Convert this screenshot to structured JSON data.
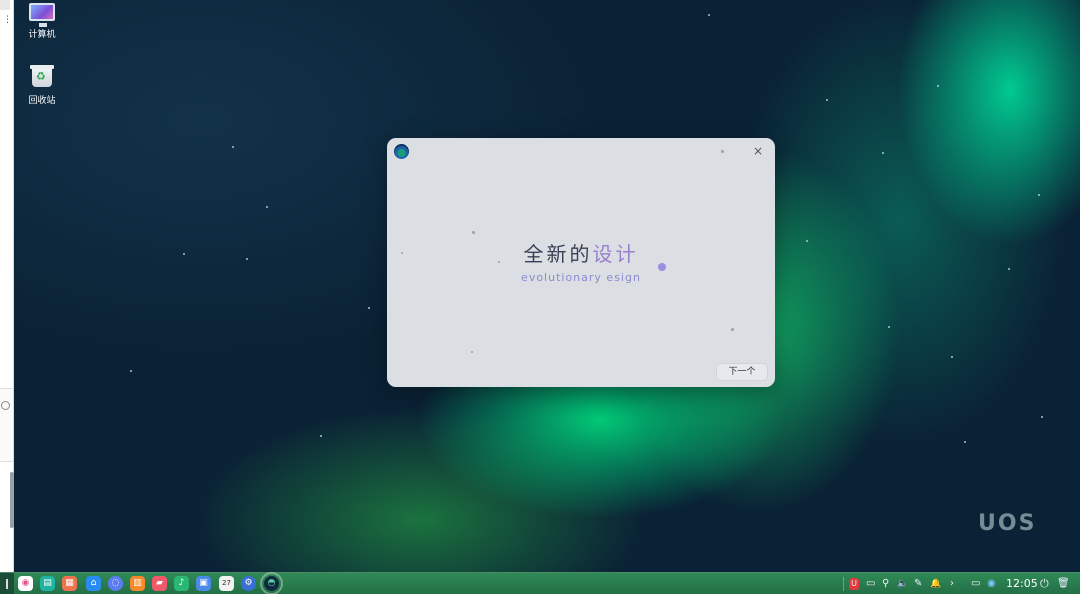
{
  "desktop": {
    "icons": [
      {
        "label": "计算机",
        "icon": "computer-icon"
      },
      {
        "label": "回收站",
        "icon": "trash-icon"
      }
    ],
    "watermark": "UOS"
  },
  "dialog": {
    "title_dark": "全新的",
    "title_light": "设计",
    "subtitle": "evolutionary  esign",
    "close_glyph": "×",
    "next_label": "下一个"
  },
  "taskbar": {
    "apps": [
      {
        "name": "launcher-icon",
        "color": "#ffffff",
        "glyph": "◉"
      },
      {
        "name": "multitask-view-icon",
        "color": "#1fb3a2",
        "glyph": "▤"
      },
      {
        "name": "file-manager-icon",
        "color": "#f0734f",
        "glyph": "▦"
      },
      {
        "name": "app-store-icon",
        "color": "#2a8cf0",
        "glyph": "⌂"
      },
      {
        "name": "browser-icon",
        "color": "#5e7cf2",
        "glyph": "◌"
      },
      {
        "name": "music-icon",
        "color": "#f58a2a",
        "glyph": "▥"
      },
      {
        "name": "image-viewer-icon",
        "color": "#ef5a6b",
        "glyph": "▰"
      },
      {
        "name": "video-icon",
        "color": "#2bb673",
        "glyph": "♪"
      },
      {
        "name": "document-icon",
        "color": "#4a8bea",
        "glyph": "▣"
      },
      {
        "name": "calendar-icon",
        "color": "#f2f2f2",
        "glyph": "27"
      },
      {
        "name": "settings-icon",
        "color": "#3b6fd8",
        "glyph": "⚙"
      },
      {
        "name": "uos-welcome-icon",
        "color": "#0f2a3f",
        "glyph": "◓"
      }
    ],
    "tray": [
      {
        "name": "security-center-icon",
        "glyph": "U"
      },
      {
        "name": "keyboard-icon",
        "glyph": "▭"
      },
      {
        "name": "usb-icon",
        "glyph": "⚲"
      },
      {
        "name": "volume-icon",
        "glyph": "🔈"
      },
      {
        "name": "pen-icon",
        "glyph": "✎"
      },
      {
        "name": "notification-icon",
        "glyph": "🔔"
      },
      {
        "name": "tray-expand-icon",
        "glyph": "›"
      },
      {
        "name": "screen-icon",
        "glyph": "▭"
      },
      {
        "name": "network-icon",
        "glyph": "◉"
      }
    ],
    "clock": "12:05",
    "power_glyph": "⏻",
    "trash_glyph": "🗑"
  }
}
